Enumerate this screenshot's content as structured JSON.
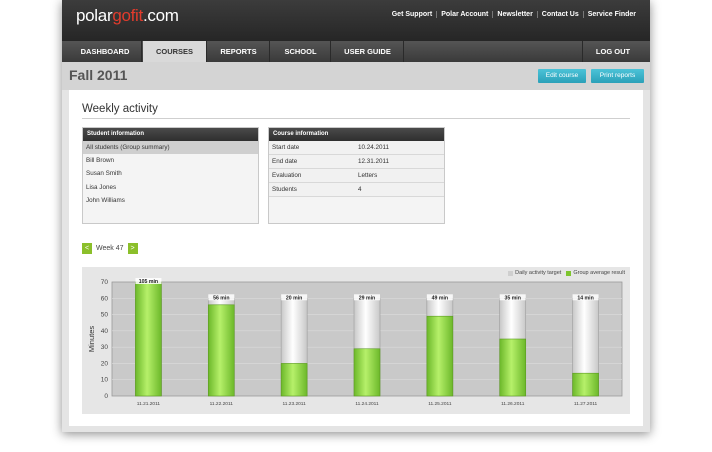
{
  "app": {
    "logo_main": "polar",
    "logo_accent": "gofit",
    "logo_suffix": ".com"
  },
  "top_links": [
    "Get Support",
    "Polar Account",
    "Newsletter",
    "Contact Us",
    "Service Finder"
  ],
  "nav": {
    "items": [
      "DASHBOARD",
      "COURSES",
      "REPORTS",
      "SCHOOL",
      "USER GUIDE"
    ],
    "active": "COURSES",
    "logout": "LOG OUT"
  },
  "page": {
    "title": "Fall 2011",
    "edit_label": "Edit course",
    "print_label": "Print reports"
  },
  "section": {
    "title": "Weekly activity"
  },
  "students": {
    "header": "Student information",
    "items": [
      "All students (Group summary)",
      "Bill Brown",
      "Susan Smith",
      "Lisa Jones",
      "John Williams"
    ],
    "selected": 0
  },
  "course": {
    "header": "Course information",
    "rows": [
      {
        "label": "Start date",
        "value": "10.24.2011"
      },
      {
        "label": "End date",
        "value": "12.31.2011"
      },
      {
        "label": "Evaluation",
        "value": "Letters"
      },
      {
        "label": "Students",
        "value": "4"
      }
    ]
  },
  "week": {
    "label": "Week 47",
    "prev": "<",
    "next": ">"
  },
  "colors": {
    "accent_teal": "#2aa0b8",
    "bar_green": "#8fd83c",
    "target_gray": "#ebebeb",
    "nav_dark": "#2f2f2f"
  },
  "chart_data": {
    "type": "bar",
    "categories": [
      "11.21.2011",
      "11.22.2011",
      "11.23.2011",
      "11.24.2011",
      "11.25.2011",
      "11.26.2011",
      "11.27.2011"
    ],
    "series": [
      {
        "name": "Daily activity target",
        "values": [
          60,
          60,
          60,
          60,
          60,
          60,
          60
        ]
      },
      {
        "name": "Group average result",
        "values": [
          105,
          56,
          20,
          29,
          49,
          35,
          14
        ]
      }
    ],
    "labels": [
      "105 min",
      "56 min",
      "20 min",
      "29 min",
      "49 min",
      "35 min",
      "14 min"
    ],
    "ylabel": "Minutes",
    "ylim": [
      0,
      70
    ],
    "yticks": [
      0,
      10,
      20,
      30,
      40,
      50,
      60,
      70
    ],
    "grid": true,
    "legend": "top-right"
  }
}
